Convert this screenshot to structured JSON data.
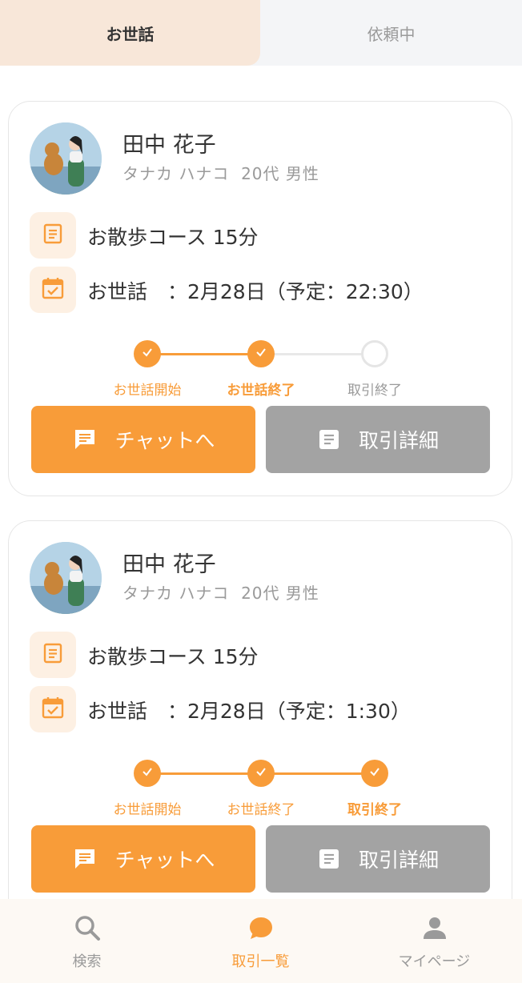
{
  "tabs": {
    "active": "お世話",
    "inactive": "依頼中"
  },
  "cards": [
    {
      "name": "田中 花子",
      "kana": "タナカ ハナコ",
      "age_gender": "20代 男性",
      "course": "お散歩コース 15分",
      "schedule": "お世話　：2月28日（予定：22:30）",
      "steps": [
        {
          "label": "お世話開始",
          "done": true,
          "current": false
        },
        {
          "label": "お世話終了",
          "done": true,
          "current": true
        },
        {
          "label": "取引終了",
          "done": false,
          "current": false
        }
      ],
      "chat_label": "チャットへ",
      "detail_label": "取引詳細"
    },
    {
      "name": "田中 花子",
      "kana": "タナカ ハナコ",
      "age_gender": "20代 男性",
      "course": "お散歩コース 15分",
      "schedule": "お世話　：2月28日（予定：1:30）",
      "steps": [
        {
          "label": "お世話開始",
          "done": true,
          "current": false
        },
        {
          "label": "お世話終了",
          "done": true,
          "current": false
        },
        {
          "label": "取引終了",
          "done": true,
          "current": true
        }
      ],
      "chat_label": "チャットへ",
      "detail_label": "取引詳細"
    }
  ],
  "nav": [
    {
      "label": "検索",
      "icon": "search-icon",
      "active": false
    },
    {
      "label": "取引一覧",
      "icon": "chat-bubble-icon",
      "active": true
    },
    {
      "label": "マイページ",
      "icon": "person-icon",
      "active": false
    }
  ],
  "colors": {
    "accent": "#f89c39",
    "gray_button": "#a3a3a3",
    "tab_active_bg": "#f8e7d9"
  }
}
